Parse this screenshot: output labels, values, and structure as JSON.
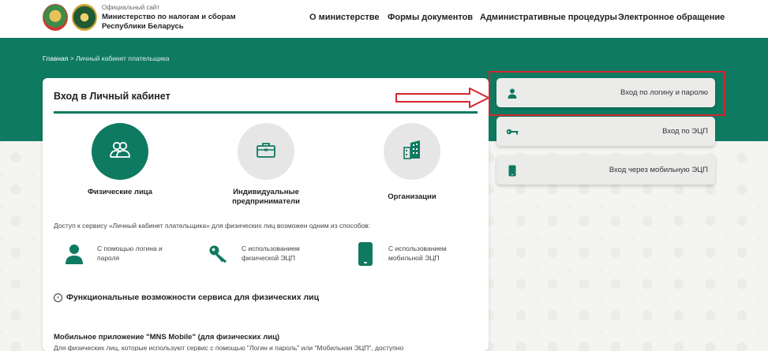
{
  "header": {
    "official_label": "Официальный сайт",
    "site_name_line1": "Министерство по налогам и сборам",
    "site_name_line2": "Республики Беларусь",
    "nav": [
      {
        "label": "О министерстве"
      },
      {
        "label": "Формы документов"
      },
      {
        "label": "Административные процедуры"
      },
      {
        "label": "Электронное обращение"
      }
    ]
  },
  "breadcrumb": {
    "home": "Главная",
    "separator": ">",
    "current": "Личный кабинет плательщика"
  },
  "card": {
    "title": "Вход в Личный кабинет",
    "categories": [
      {
        "label": "Физические лица",
        "active": true,
        "icon": "people-icon"
      },
      {
        "label": "Индивидуальные предприниматели",
        "active": false,
        "icon": "briefcase-icon"
      },
      {
        "label": "Организации",
        "active": false,
        "icon": "building-icon"
      }
    ],
    "access_description": "Доступ к сервису «Личный кабинет плательщика» для физических лиц возможен одним из способов:",
    "methods": [
      {
        "label": "С помощью логина и пароля",
        "icon": "user-icon"
      },
      {
        "label": "С использованием физической ЭЦП",
        "icon": "key-icon"
      },
      {
        "label": "С использованием мобильной ЭЦП",
        "icon": "mobile-icon"
      }
    ],
    "features_label": "Функциональные возможности сервиса для физических лиц",
    "mobile_app_title": "Мобильное приложение \"MNS Mobile\" (для физических лиц)",
    "mobile_app_text": "Для физических лиц, которые используют сервис с помощью \"Логин и пароль\" или \"Мобильная ЭЦП\", доступно"
  },
  "login_options": [
    {
      "label": "Вход по логину и паролю",
      "icon": "user-icon",
      "highlighted": true
    },
    {
      "label": "Вход по ЭЦП",
      "icon": "key-icon",
      "highlighted": false
    },
    {
      "label": "Вход через мобильную ЭЦП",
      "icon": "mobile-icon",
      "highlighted": false
    }
  ],
  "colors": {
    "brand_green": "#0e7a61",
    "highlight_red": "#d6262d",
    "arrow_red": "#d6262d"
  }
}
